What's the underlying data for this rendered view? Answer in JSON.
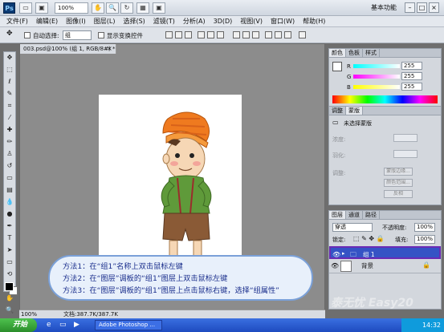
{
  "appbar": {
    "logo": "Ps",
    "zoom": "100%",
    "workspace": "基本功能",
    "buttons": [
      "▭",
      "▣",
      "✋",
      "🔍",
      "↻",
      "▦",
      "▣",
      "☰"
    ]
  },
  "menu": [
    "文件(F)",
    "编辑(E)",
    "图像(I)",
    "图层(L)",
    "选择(S)",
    "滤镜(T)",
    "分析(A)",
    "3D(D)",
    "视图(V)",
    "窗口(W)",
    "帮助(H)"
  ],
  "options": {
    "auto_select_label": "自动选择:",
    "auto_select_value": "组",
    "show_transform_label": "显示变换控件"
  },
  "document": {
    "tab_title": "003.psd@100% (组 1, RGB/8#) *",
    "close": "×",
    "zoom": "100%",
    "doc_info": "文档:387.7K/387.7K"
  },
  "tip": {
    "lines": [
      "方法1：在“组1”名称上双击鼠标左键",
      "方法2：在“图层”调板的“组1”图层上双击鼠标左键",
      "方法3：在“图层”调板的“组1”图层上点击鼠标右键，选择“组属性”"
    ]
  },
  "color_panel": {
    "tabs": [
      "颜色",
      "色板",
      "样式"
    ],
    "channels": [
      {
        "label": "R",
        "value": "255",
        "color": "#ff3b3b"
      },
      {
        "label": "G",
        "value": "255",
        "color": "#39e039"
      },
      {
        "label": "B",
        "value": "255",
        "color": "#3a5bff"
      }
    ]
  },
  "adjust_panel": {
    "tabs": [
      "调整",
      "蒙版"
    ],
    "title": "未选择蒙版",
    "density": "浓度:",
    "feather": "羽化:",
    "refine": "调整:",
    "buttons": [
      "蒙版边缘...",
      "颜色范围...",
      "反相"
    ]
  },
  "layers_panel": {
    "tabs": [
      "图层",
      "通道",
      "路径"
    ],
    "blend_mode": "穿透",
    "opacity_label": "不透明度:",
    "opacity": "100%",
    "lock_label": "锁定:",
    "fill_label": "填充:",
    "fill": "100%",
    "layers": [
      {
        "name": "组 1",
        "selected": true
      },
      {
        "name": "背景",
        "selected": false
      }
    ]
  },
  "taskbar": {
    "start": "开始",
    "task": "Adobe Photoshop ...",
    "time": "14:32"
  },
  "watermark": "泰无忧 Easy20"
}
